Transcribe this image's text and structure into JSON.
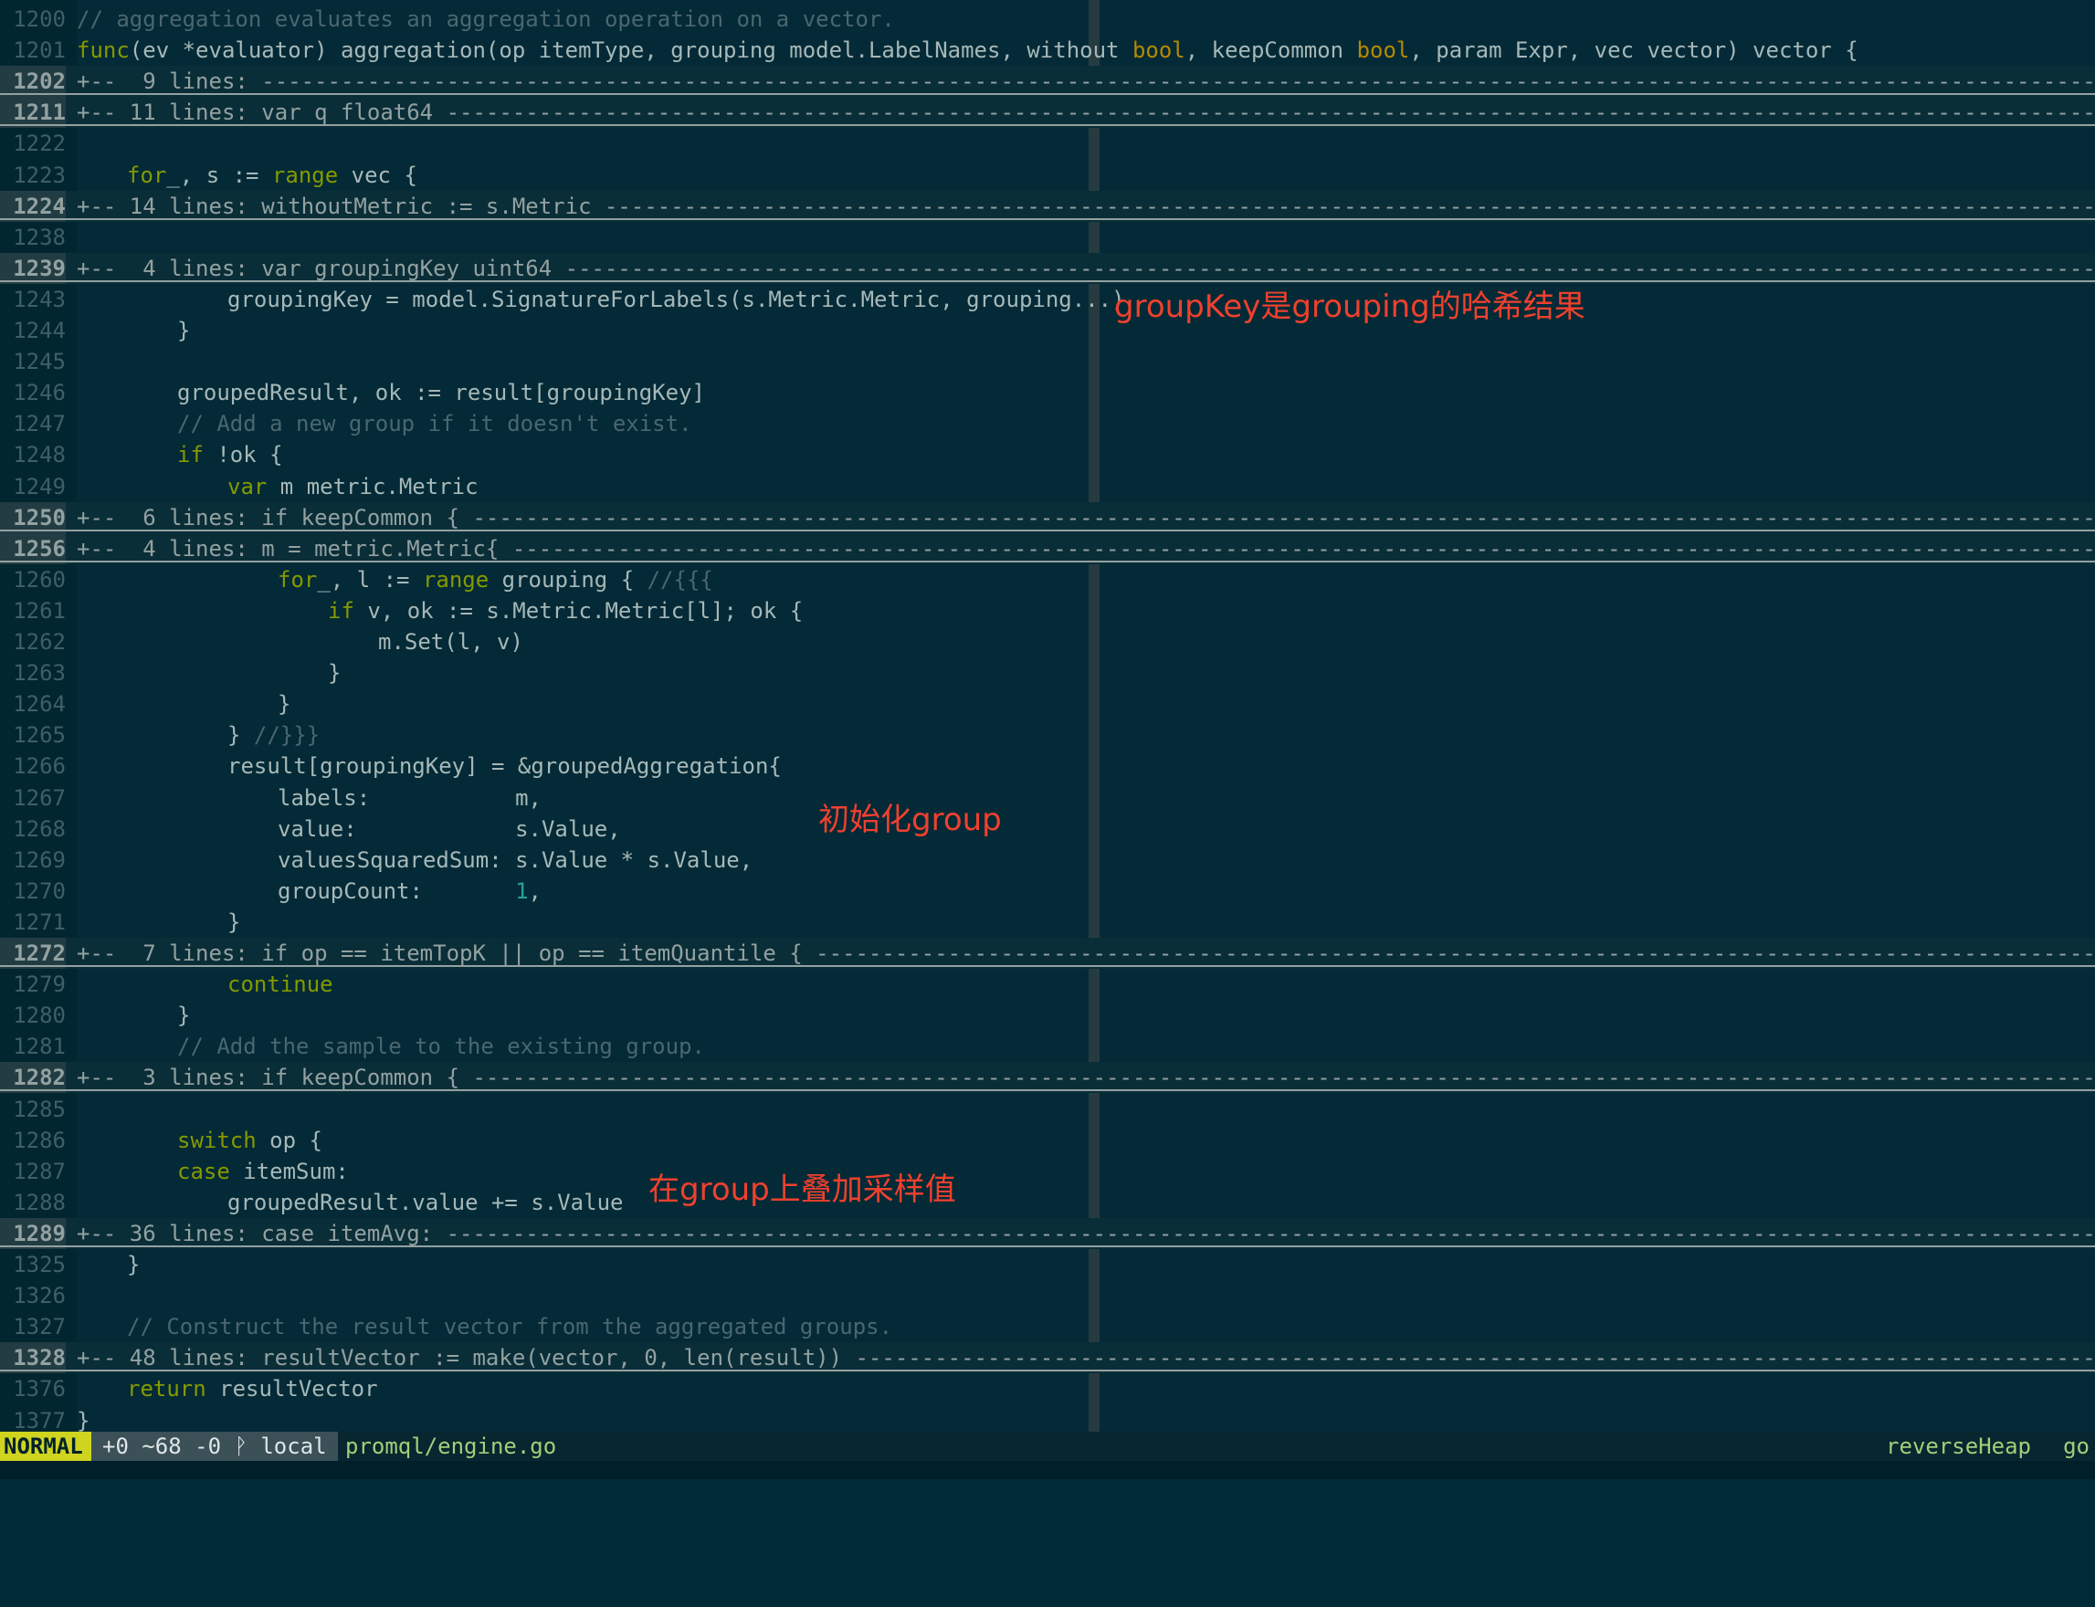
{
  "editor": {
    "lines": [
      {
        "n": "1200",
        "kind": "code",
        "indent": 0,
        "tokens": [
          [
            "cm",
            "// aggregation evaluates an aggregation operation on a vector."
          ]
        ]
      },
      {
        "n": "1201",
        "kind": "code",
        "indent": 0,
        "tokens": [
          [
            "kw",
            "func"
          ],
          [
            "",
            "(ev *evaluator) aggregation(op itemType, grouping model.LabelNames, without "
          ],
          [
            "ty",
            "bool"
          ],
          [
            "",
            ", keepCommon "
          ],
          [
            "ty",
            "bool"
          ],
          [
            "",
            ", param Expr, vec vector) vector {"
          ]
        ]
      },
      {
        "n": "1202",
        "kind": "fold",
        "text": "+--  9 lines: -----------------------------------------------------------------------------------------------------------------------------------------------------------"
      },
      {
        "n": "1211",
        "kind": "fold",
        "text": "+-- 11 lines: var q float64 -----------------------------------------------------------------------------------------------------------------------------------------------------------"
      },
      {
        "n": "1222",
        "kind": "code",
        "indent": 0,
        "tokens": []
      },
      {
        "n": "1223",
        "kind": "code",
        "indent": 1,
        "tokens": [
          [
            "kw",
            "for"
          ],
          [
            "",
            "_, s := "
          ],
          [
            "kw",
            "range"
          ],
          [
            "",
            " vec {"
          ]
        ]
      },
      {
        "n": "1224",
        "kind": "fold",
        "text": "+-- 14 lines: withoutMetric := s.Metric -----------------------------------------------------------------------------------------------------------------------------------------------------------"
      },
      {
        "n": "1238",
        "kind": "code",
        "indent": 0,
        "tokens": []
      },
      {
        "n": "1239",
        "kind": "fold",
        "text": "+--  4 lines: var groupingKey uint64 -----------------------------------------------------------------------------------------------------------------------------------------------------------"
      },
      {
        "n": "1243",
        "kind": "code",
        "indent": 3,
        "tokens": [
          [
            "",
            "groupingKey = model.SignatureForLabels(s.Metric.Metric, grouping...)"
          ]
        ]
      },
      {
        "n": "1244",
        "kind": "code",
        "indent": 2,
        "tokens": [
          [
            "",
            "}"
          ]
        ]
      },
      {
        "n": "1245",
        "kind": "code",
        "indent": 0,
        "tokens": []
      },
      {
        "n": "1246",
        "kind": "code",
        "indent": 2,
        "tokens": [
          [
            "",
            "groupedResult, ok := result[groupingKey]"
          ]
        ]
      },
      {
        "n": "1247",
        "kind": "code",
        "indent": 2,
        "tokens": [
          [
            "cm",
            "// Add a new group if it doesn't exist."
          ]
        ]
      },
      {
        "n": "1248",
        "kind": "code",
        "indent": 2,
        "tokens": [
          [
            "kw",
            "if"
          ],
          [
            "",
            " !ok {"
          ]
        ]
      },
      {
        "n": "1249",
        "kind": "code",
        "indent": 3,
        "tokens": [
          [
            "kw",
            "var"
          ],
          [
            "",
            " m metric.Metric"
          ]
        ]
      },
      {
        "n": "1250",
        "kind": "fold",
        "text": "+--  6 lines: if keepCommon { -----------------------------------------------------------------------------------------------------------------------------------------------------------"
      },
      {
        "n": "1256",
        "kind": "fold",
        "text": "+--  4 lines: m = metric.Metric{ -----------------------------------------------------------------------------------------------------------------------------------------------------------"
      },
      {
        "n": "1260",
        "kind": "code",
        "indent": 4,
        "tokens": [
          [
            "kw",
            "for"
          ],
          [
            "",
            "_, l := "
          ],
          [
            "kw",
            "range"
          ],
          [
            "",
            " grouping { "
          ],
          [
            "cm",
            "//{{{"
          ]
        ]
      },
      {
        "n": "1261",
        "kind": "code",
        "indent": 5,
        "tokens": [
          [
            "kw",
            "if"
          ],
          [
            "",
            " v, ok := s.Metric.Metric[l]; ok {"
          ]
        ]
      },
      {
        "n": "1262",
        "kind": "code",
        "indent": 6,
        "tokens": [
          [
            "",
            "m.Set(l, v)"
          ]
        ]
      },
      {
        "n": "1263",
        "kind": "code",
        "indent": 5,
        "tokens": [
          [
            "",
            "}"
          ]
        ]
      },
      {
        "n": "1264",
        "kind": "code",
        "indent": 4,
        "tokens": [
          [
            "",
            "}"
          ]
        ]
      },
      {
        "n": "1265",
        "kind": "code",
        "indent": 3,
        "tokens": [
          [
            "",
            "} "
          ],
          [
            "cm",
            "//}}}"
          ]
        ]
      },
      {
        "n": "1266",
        "kind": "code",
        "indent": 3,
        "tokens": [
          [
            "",
            "result[groupingKey] = &groupedAggregation{"
          ]
        ]
      },
      {
        "n": "1267",
        "kind": "code",
        "indent": 4,
        "tokens": [
          [
            "",
            "labels:           m,"
          ]
        ]
      },
      {
        "n": "1268",
        "kind": "code",
        "indent": 4,
        "tokens": [
          [
            "",
            "value:            s.Value,"
          ]
        ]
      },
      {
        "n": "1269",
        "kind": "code",
        "indent": 4,
        "tokens": [
          [
            "",
            "valuesSquaredSum: s.Value * s.Value,"
          ]
        ]
      },
      {
        "n": "1270",
        "kind": "code",
        "indent": 4,
        "tokens": [
          [
            "",
            "groupCount:       "
          ],
          [
            "nu",
            "1"
          ],
          [
            "",
            ","
          ]
        ]
      },
      {
        "n": "1271",
        "kind": "code",
        "indent": 3,
        "tokens": [
          [
            "",
            "}"
          ]
        ]
      },
      {
        "n": "1272",
        "kind": "fold",
        "text": "+--  7 lines: if op == itemTopK || op == itemQuantile { -----------------------------------------------------------------------------------------------------------------------------------------------------------"
      },
      {
        "n": "1279",
        "kind": "code",
        "indent": 3,
        "tokens": [
          [
            "kw",
            "continue"
          ]
        ]
      },
      {
        "n": "1280",
        "kind": "code",
        "indent": 2,
        "tokens": [
          [
            "",
            "}"
          ]
        ]
      },
      {
        "n": "1281",
        "kind": "code",
        "indent": 2,
        "tokens": [
          [
            "cm",
            "// Add the sample to the existing group."
          ]
        ]
      },
      {
        "n": "1282",
        "kind": "fold",
        "text": "+--  3 lines: if keepCommon { -----------------------------------------------------------------------------------------------------------------------------------------------------------"
      },
      {
        "n": "1285",
        "kind": "code",
        "indent": 0,
        "tokens": []
      },
      {
        "n": "1286",
        "kind": "code",
        "indent": 2,
        "tokens": [
          [
            "kw",
            "switch"
          ],
          [
            "",
            " op {"
          ]
        ]
      },
      {
        "n": "1287",
        "kind": "code",
        "indent": 2,
        "tokens": [
          [
            "kw",
            "case"
          ],
          [
            "",
            " itemSum:"
          ]
        ]
      },
      {
        "n": "1288",
        "kind": "code",
        "indent": 3,
        "tokens": [
          [
            "",
            "groupedResult.value += s.Value"
          ]
        ]
      },
      {
        "n": "1289",
        "kind": "fold",
        "text": "+-- 36 lines: case itemAvg: -----------------------------------------------------------------------------------------------------------------------------------------------------------"
      },
      {
        "n": "1325",
        "kind": "code",
        "indent": 1,
        "tokens": [
          [
            "",
            "}"
          ]
        ]
      },
      {
        "n": "1326",
        "kind": "code",
        "indent": 0,
        "tokens": []
      },
      {
        "n": "1327",
        "kind": "code",
        "indent": 1,
        "tokens": [
          [
            "cm",
            "// Construct the result vector from the aggregated groups."
          ]
        ]
      },
      {
        "n": "1328",
        "kind": "fold",
        "text": "+-- 48 lines: resultVector := make(vector, 0, len(result)) -----------------------------------------------------------------------------------------------------------------------------------------------------------"
      },
      {
        "n": "1376",
        "kind": "code",
        "indent": 1,
        "tokens": [
          [
            "kw",
            "return"
          ],
          [
            "",
            " resultVector"
          ]
        ]
      },
      {
        "n": "1377",
        "kind": "code",
        "indent": 0,
        "tokens": [
          [
            "",
            "}"
          ]
        ]
      }
    ]
  },
  "annotations": {
    "grouping_hash": "groupKey是grouping的哈希结果",
    "init_group": "初始化group",
    "accumulate": "在group上叠加采样值"
  },
  "statusline": {
    "mode": "NORMAL",
    "git": "+0 ~68 -0 ᚹ local",
    "filename": "promql/engine.go",
    "function": "reverseHeap",
    "filetype": "go"
  },
  "colors": {
    "background": "#032a36",
    "keyword": "#859900",
    "type": "#b58900",
    "number": "#2aa198",
    "comment": "#4a6770",
    "annotation": "#f0402e",
    "mode_bg": "#cfd41f"
  }
}
